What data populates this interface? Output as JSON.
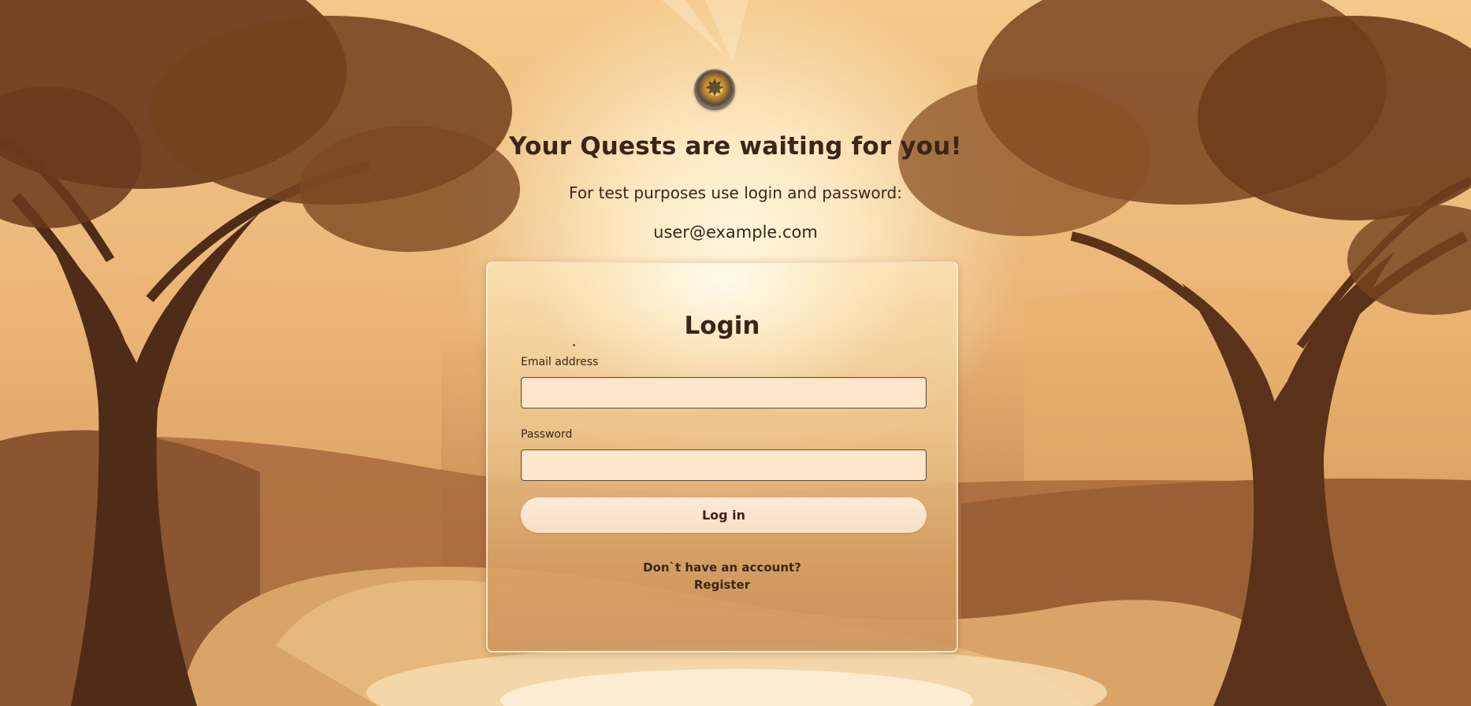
{
  "header": {
    "logo_icon": "compass-star-emblem-icon",
    "headline": "Your Quests are waiting for you!",
    "subtext": "For test purposes use login and password:",
    "credentials": "user@example.com"
  },
  "login": {
    "title": "Login",
    "email_label": "Email address",
    "email_value": "",
    "password_label": "Password",
    "password_value": "",
    "submit_label": "Log in",
    "no_account_text": "Don`t have an account?",
    "register_label": "Register"
  },
  "colors": {
    "text": "#3b2519",
    "input_bg": "#fde6cc",
    "button_bg": "#fbe6cf",
    "sky": "#f3c98a"
  }
}
